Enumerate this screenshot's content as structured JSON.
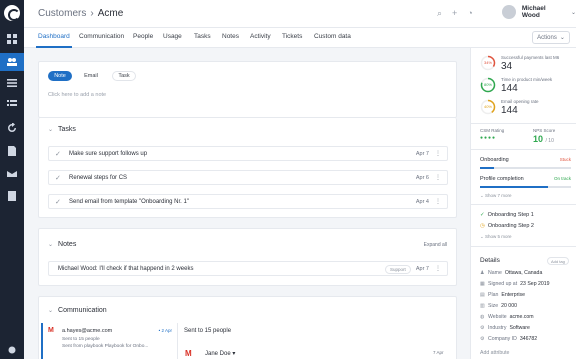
{
  "breadcrumb": {
    "parent": "Customers",
    "current": "Acme"
  },
  "header": {
    "user_name": "Michael Wood",
    "icons": [
      "search-icon",
      "plus-icon",
      "bell-icon"
    ]
  },
  "tabs": [
    "Dashboard",
    "Communication",
    "People",
    "Usage",
    "Tasks",
    "Notes",
    "Activity",
    "Tickets",
    "Custom data"
  ],
  "actions_label": "Actions",
  "composer": {
    "types": [
      "Note",
      "Email",
      "Task"
    ],
    "placeholder": "Click here to add a note"
  },
  "tasks": {
    "title": "Tasks",
    "items": [
      {
        "label": "Make sure support follows up",
        "date": "Apr 7"
      },
      {
        "label": "Renewal steps for CS",
        "date": "Apr 6"
      },
      {
        "label": "Send email from template \"Onboarding Nr. 1\"",
        "date": "Apr 4"
      }
    ]
  },
  "notes": {
    "title": "Notes",
    "expand_label": "Expand all",
    "items": [
      {
        "text": "Michael Wood: I'll check if that happend in 2 weeks",
        "tag": "Support",
        "date": "Apr 7"
      }
    ]
  },
  "communication": {
    "title": "Communication",
    "email": {
      "from": "a.hayes@acme.com",
      "ago": "• 2 Apr",
      "line2": "Sent to 15 people",
      "line3": "Sent from playbook Playbook for Onbo..."
    },
    "detail_title": "Sent to 15 people",
    "detail_sender": "Jane Doe",
    "detail_date": "7 Apr"
  },
  "metrics": [
    {
      "label": "Successful payments last M6",
      "value": "34",
      "ring": "34%",
      "percent": 34,
      "color": "#e0533d"
    },
    {
      "label": "Time in product min/week",
      "value": "144",
      "ring": "80%",
      "percent": 80,
      "color": "#2fa84f"
    },
    {
      "label": "Email opening rate",
      "value": "144",
      "ring": "40%",
      "percent": 40,
      "color": "#e0a21a"
    }
  ],
  "csm": {
    "label": "CSM Rating",
    "stars": "●●●●",
    "rating": 4
  },
  "nps": {
    "label": "NPS Score",
    "value": "10",
    "suffix": "/ 10"
  },
  "onboarding": {
    "label": "Onboarding",
    "status": "Stuck",
    "status_color": "#e0533d",
    "progress": 0.15
  },
  "profile": {
    "label": "Profile completion",
    "status": "On track",
    "status_color": "#2fa84f",
    "progress": 0.75
  },
  "show_more_1": "Show 7 more",
  "steps": [
    {
      "label": "Onboarding Step 1",
      "done": true
    },
    {
      "label": "Onboarding Step 2",
      "done": false
    }
  ],
  "show_more_2": "Show 5 more",
  "details": {
    "title": "Details",
    "add_tag": "Add tag",
    "rows": [
      {
        "icon": "user-icon",
        "glyph": "♟",
        "key": "Name",
        "value": "Ottawa, Canada"
      },
      {
        "icon": "calendar-icon",
        "glyph": "▦",
        "key": "Signed up at",
        "value": "23 Sep 2019"
      },
      {
        "icon": "plan-icon",
        "glyph": "▤",
        "key": "Plan",
        "value": "Enterprise"
      },
      {
        "icon": "size-icon",
        "glyph": "▥",
        "key": "Size",
        "value": "20 000"
      },
      {
        "icon": "website-icon",
        "glyph": "◍",
        "key": "Website",
        "value": "acme.com"
      },
      {
        "icon": "industry-icon",
        "glyph": "⚙",
        "key": "Industry",
        "value": "Software"
      },
      {
        "icon": "company-id-icon",
        "glyph": "⚙",
        "key": "Company ID",
        "value": "346782"
      }
    ],
    "add_attribute": "Add attribute"
  }
}
